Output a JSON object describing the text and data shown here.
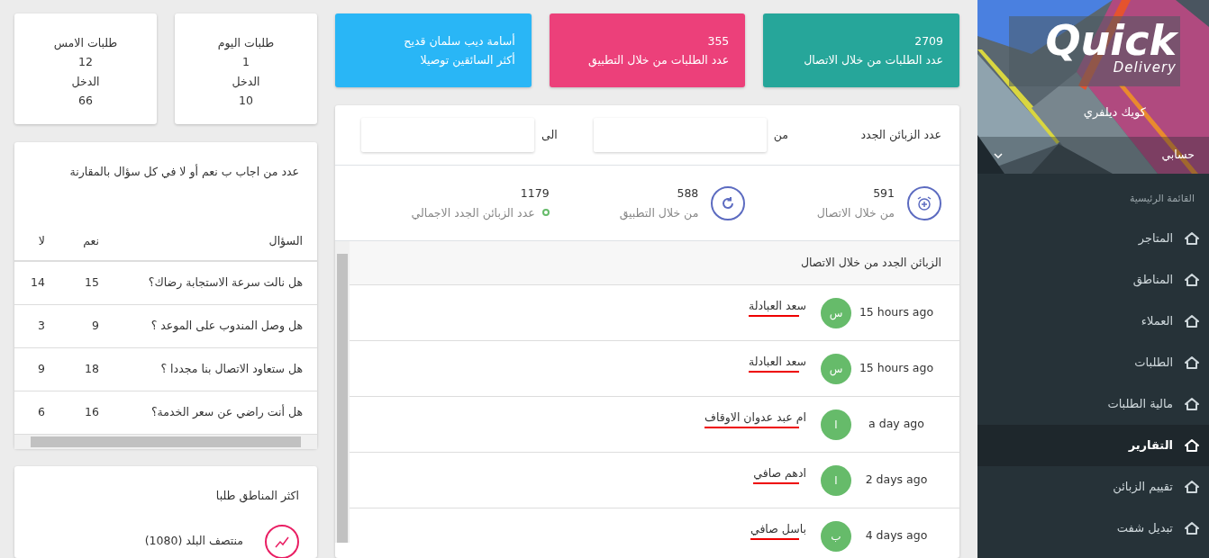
{
  "sidebar": {
    "logo": {
      "word": "Quick",
      "tagline": "Delivery"
    },
    "brand_name": "كويك ديلفري",
    "account": "حسابي",
    "section_label": "القائمة الرئيسية",
    "items": [
      {
        "label": "المتاجر",
        "selected": false
      },
      {
        "label": "المناطق",
        "selected": false
      },
      {
        "label": "العملاء",
        "selected": false
      },
      {
        "label": "الطلبات",
        "selected": false
      },
      {
        "label": "مالية الطلبات",
        "selected": false
      },
      {
        "label": "التقارير",
        "selected": true
      },
      {
        "label": "تقييم الزبائن",
        "selected": false
      },
      {
        "label": "تبديل شفت",
        "selected": false
      }
    ]
  },
  "stat_tiles": [
    {
      "line_1": "2709",
      "line_2": "عدد الطلبات من خلال الاتصال",
      "color": "#26a69a"
    },
    {
      "line_1": "355",
      "line_2": "عدد الطلبات من خلال التطبيق",
      "color": "#ec407a"
    },
    {
      "line_1": "أسامة ديب سلمان قديح",
      "line_2": "أكثر السائقين توصيلا",
      "color": "#29b6f6"
    }
  ],
  "new_customers": {
    "title": "عدد الزبائن الجدد",
    "from_label": "من",
    "to_label": "الى",
    "stats": [
      {
        "kind": "alarm",
        "value": "591",
        "label": "من خلال الاتصال"
      },
      {
        "kind": "refresh",
        "value": "588",
        "label": "من خلال التطبيق"
      },
      {
        "kind": "dot",
        "value": "1179",
        "label": "عدد الزبائن الجدد الاجمالي"
      }
    ]
  },
  "call_customers": {
    "title": "الزبائن الجدد من خلال الاتصال",
    "rows": [
      {
        "time": "15 hours ago",
        "initial": "س",
        "name": "سعد العبادلة"
      },
      {
        "time": "15 hours ago",
        "initial": "س",
        "name": "سعد العبادلة"
      },
      {
        "time": "a day ago",
        "initial": "ا",
        "name": "ام عبد عدوان الاوقاف"
      },
      {
        "time": "2 days ago",
        "initial": "ا",
        "name": "ادهم صافي"
      },
      {
        "time": "4 days ago",
        "initial": "ب",
        "name": "باسل صافي"
      }
    ]
  },
  "daily": [
    {
      "title": "طلبات اليوم",
      "count": "1",
      "income_label": "الدخل",
      "income": "10"
    },
    {
      "title": "طلبات الامس",
      "count": "12",
      "income_label": "الدخل",
      "income": "66"
    }
  ],
  "survey": {
    "title": "عدد من اجاب ب نعم أو لا في كل سؤال بالمقارنة",
    "columns": [
      "السؤال",
      "نعم",
      "لا"
    ],
    "rows": [
      {
        "question": "هل نالت سرعة الاستجابة رضاك؟",
        "yes": "15",
        "no": "14"
      },
      {
        "question": "هل وصل المندوب على الموعد ؟",
        "yes": "9",
        "no": "3"
      },
      {
        "question": "هل ستعاود الاتصال بنا مجددا ؟",
        "yes": "18",
        "no": "9"
      },
      {
        "question": "هل أنت راضي عن سعر الخدمة؟",
        "yes": "16",
        "no": "6"
      }
    ]
  },
  "regions": {
    "title": "اكثر المناطق طلبا",
    "items": [
      {
        "label": "منتصف البلد (1080)"
      }
    ]
  }
}
